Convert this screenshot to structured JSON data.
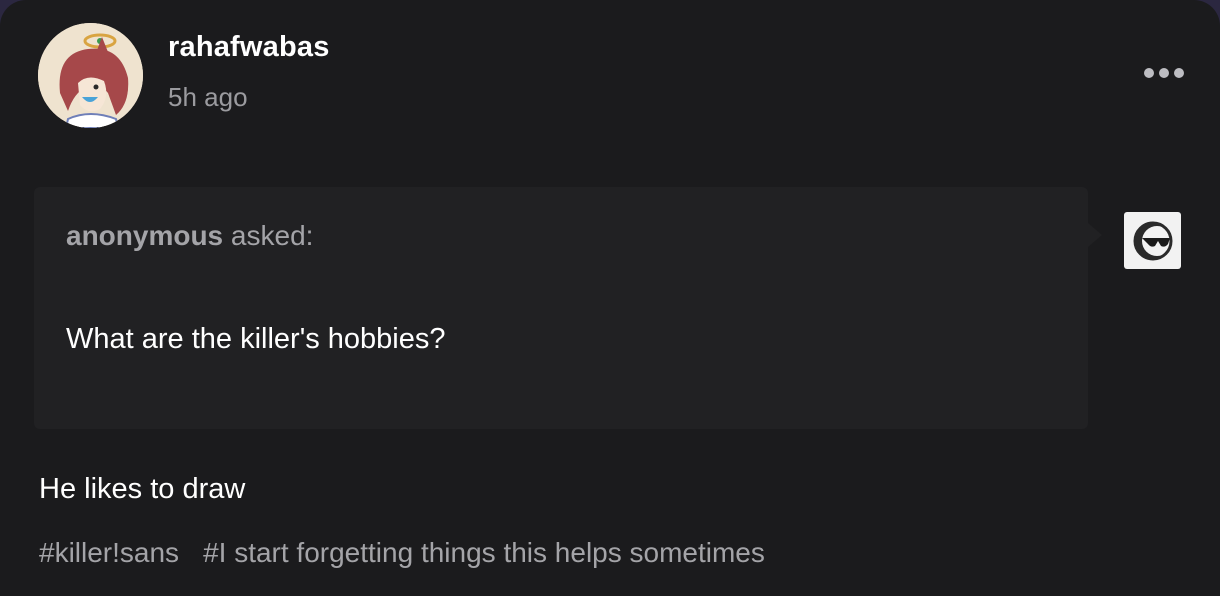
{
  "post": {
    "username": "rahafwabas",
    "timestamp": "5h ago",
    "asker": {
      "name": "anonymous",
      "verb": "asked:"
    },
    "question": "What are the killer's hobbies?",
    "answer": "He likes to draw",
    "tags": [
      "#killer!sans",
      "#I start forgetting things this helps sometimes"
    ]
  },
  "icons": {
    "more": "more-options-icon",
    "avatar": "user-avatar",
    "anonymous_avatar": "anonymous-sunglasses-icon"
  },
  "colors": {
    "page_background": "#2b2740",
    "card_background": "#1b1b1d",
    "ask_box_background": "#212123",
    "primary_text": "#ffffff",
    "secondary_text": "#a4a4a8"
  }
}
